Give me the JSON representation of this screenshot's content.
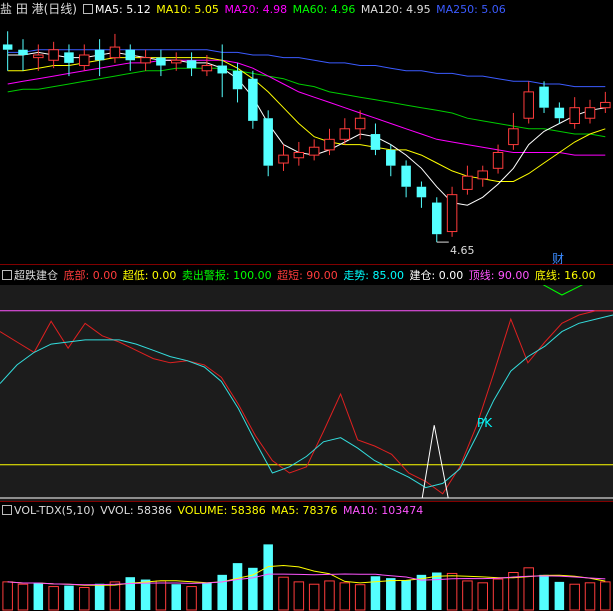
{
  "header": {
    "title": "盐 田 港(日线)",
    "indicators": [
      {
        "label": "MA5: 5.12",
        "color": "#ffffff"
      },
      {
        "label": "MA10: 5.05",
        "color": "#ffff00"
      },
      {
        "label": "MA20: 4.98",
        "color": "#ff00ff"
      },
      {
        "label": "MA60: 4.96",
        "color": "#00ff00"
      },
      {
        "label": "MA120: 4.95",
        "color": "#dddddd"
      },
      {
        "label": "MA250: 5.06",
        "color": "#3b5bff"
      }
    ]
  },
  "price_chart": {
    "low_marker": "4.65",
    "finance_badge": "财",
    "candles": [
      [
        5.4,
        5.38,
        5.45,
        5.3
      ],
      [
        5.38,
        5.36,
        5.42,
        5.3
      ],
      [
        5.35,
        5.36,
        5.4,
        5.3
      ],
      [
        5.34,
        5.38,
        5.41,
        5.31
      ],
      [
        5.37,
        5.33,
        5.4,
        5.28
      ],
      [
        5.32,
        5.36,
        5.4,
        5.3
      ],
      [
        5.38,
        5.34,
        5.42,
        5.28
      ],
      [
        5.35,
        5.39,
        5.44,
        5.33
      ],
      [
        5.38,
        5.34,
        5.4,
        5.3
      ],
      [
        5.33,
        5.35,
        5.38,
        5.3
      ],
      [
        5.35,
        5.32,
        5.38,
        5.28
      ],
      [
        5.33,
        5.34,
        5.37,
        5.3
      ],
      [
        5.34,
        5.31,
        5.37,
        5.28
      ],
      [
        5.3,
        5.32,
        5.36,
        5.28
      ],
      [
        5.32,
        5.29,
        5.4,
        5.2
      ],
      [
        5.3,
        5.23,
        5.33,
        5.18
      ],
      [
        5.27,
        5.11,
        5.3,
        5.08
      ],
      [
        5.12,
        4.94,
        5.15,
        4.9
      ],
      [
        4.95,
        4.98,
        5.02,
        4.92
      ],
      [
        4.97,
        4.99,
        5.03,
        4.94
      ],
      [
        4.98,
        5.01,
        5.04,
        4.96
      ],
      [
        5.0,
        5.04,
        5.08,
        4.98
      ],
      [
        5.04,
        5.08,
        5.12,
        5.02
      ],
      [
        5.08,
        5.12,
        5.15,
        5.04
      ],
      [
        5.06,
        5.0,
        5.1,
        4.98
      ],
      [
        5.0,
        4.94,
        5.02,
        4.9
      ],
      [
        4.94,
        4.86,
        4.96,
        4.82
      ],
      [
        4.86,
        4.82,
        4.88,
        4.78
      ],
      [
        4.8,
        4.68,
        4.82,
        4.65
      ],
      [
        4.69,
        4.83,
        4.86,
        4.67
      ],
      [
        4.85,
        4.9,
        4.94,
        4.83
      ],
      [
        4.89,
        4.92,
        4.94,
        4.86
      ],
      [
        4.93,
        4.99,
        5.02,
        4.91
      ],
      [
        5.02,
        5.08,
        5.14,
        5.0
      ],
      [
        5.12,
        5.22,
        5.26,
        5.1
      ],
      [
        5.24,
        5.16,
        5.26,
        5.14
      ],
      [
        5.16,
        5.12,
        5.18,
        5.1
      ],
      [
        5.1,
        5.16,
        5.2,
        5.08
      ],
      [
        5.12,
        5.16,
        5.19,
        5.1
      ],
      [
        5.16,
        5.18,
        5.22,
        5.14
      ]
    ],
    "ma5": [
      5.36,
      5.36,
      5.37,
      5.36,
      5.35,
      5.35,
      5.36,
      5.37,
      5.36,
      5.35,
      5.34,
      5.34,
      5.33,
      5.33,
      5.31,
      5.27,
      5.2,
      5.1,
      5.02,
      4.99,
      4.98,
      5.0,
      5.03,
      5.06,
      5.05,
      5.02,
      4.98,
      4.93,
      4.86,
      4.8,
      4.79,
      4.82,
      4.87,
      4.93,
      5.02,
      5.07,
      5.1,
      5.13,
      5.15,
      5.16
    ],
    "ma10": [
      5.3,
      5.3,
      5.31,
      5.32,
      5.32,
      5.33,
      5.34,
      5.35,
      5.35,
      5.35,
      5.35,
      5.35,
      5.35,
      5.35,
      5.34,
      5.31,
      5.27,
      5.22,
      5.16,
      5.1,
      5.05,
      5.03,
      5.02,
      5.02,
      5.01,
      5.0,
      5.0,
      4.98,
      4.95,
      4.92,
      4.9,
      4.89,
      4.88,
      4.88,
      4.91,
      4.95,
      4.99,
      5.03,
      5.06,
      5.08
    ],
    "ma20": [
      5.25,
      5.26,
      5.27,
      5.28,
      5.29,
      5.3,
      5.31,
      5.32,
      5.33,
      5.33,
      5.34,
      5.34,
      5.34,
      5.34,
      5.34,
      5.33,
      5.31,
      5.28,
      5.25,
      5.22,
      5.2,
      5.18,
      5.16,
      5.14,
      5.12,
      5.1,
      5.08,
      5.06,
      5.04,
      5.03,
      5.02,
      5.01,
      5.0,
      4.99,
      4.99,
      4.99,
      4.99,
      4.98,
      4.98,
      4.98
    ],
    "ma60": [
      5.22,
      5.23,
      5.23,
      5.24,
      5.25,
      5.26,
      5.27,
      5.28,
      5.29,
      5.3,
      5.3,
      5.31,
      5.31,
      5.31,
      5.31,
      5.3,
      5.29,
      5.28,
      5.27,
      5.25,
      5.24,
      5.22,
      5.21,
      5.2,
      5.19,
      5.18,
      5.17,
      5.16,
      5.15,
      5.14,
      5.12,
      5.11,
      5.1,
      5.09,
      5.08,
      5.08,
      5.07,
      5.06,
      5.06,
      5.05
    ],
    "ma250": [
      5.37,
      5.37,
      5.38,
      5.38,
      5.38,
      5.38,
      5.38,
      5.38,
      5.38,
      5.38,
      5.38,
      5.38,
      5.38,
      5.38,
      5.37,
      5.37,
      5.36,
      5.36,
      5.35,
      5.35,
      5.34,
      5.33,
      5.33,
      5.32,
      5.32,
      5.31,
      5.3,
      5.3,
      5.29,
      5.29,
      5.28,
      5.28,
      5.27,
      5.26,
      5.26,
      5.25,
      5.25,
      5.24,
      5.24,
      5.24
    ]
  },
  "ind_header": {
    "title": "超跌建仓",
    "items": [
      {
        "label": "底部: 0.00",
        "color": "#ff3c3c"
      },
      {
        "label": "超低: 0.00",
        "color": "#ffff00"
      },
      {
        "label": "卖出警报: 100.00",
        "color": "#00ff00"
      },
      {
        "label": "超短: 90.00",
        "color": "#ff3c3c"
      },
      {
        "label": "走势: 85.00",
        "color": "#00ffff"
      },
      {
        "label": "建仓: 0.00",
        "color": "#ffffff"
      },
      {
        "label": "顶线: 90.00",
        "color": "#ff55ff"
      },
      {
        "label": "底线: 16.00",
        "color": "#ffff00"
      }
    ],
    "pk_label": "PK",
    "top_line": 90,
    "bottom_line": 16,
    "red_line": [
      80,
      75,
      70,
      85,
      72,
      84,
      78,
      75,
      71,
      67,
      65,
      66,
      64,
      58,
      45,
      30,
      18,
      12,
      15,
      32,
      50,
      28,
      25,
      21,
      12,
      8,
      2,
      15,
      35,
      60,
      86,
      65,
      75,
      84,
      88,
      90,
      90
    ],
    "cyan_line": [
      55,
      64,
      70,
      74,
      75,
      76,
      76,
      76,
      74,
      71,
      68,
      66,
      63,
      56,
      43,
      27,
      12,
      15,
      20,
      27,
      29,
      24,
      18,
      14,
      10,
      5,
      7,
      14,
      30,
      47,
      61,
      68,
      73,
      80,
      84,
      86,
      88
    ]
  },
  "vol_header": {
    "title": "VOL-TDX(5,10)",
    "items": [
      {
        "label": "VVOL: 58386",
        "color": "#dddddd"
      },
      {
        "label": "VOLUME: 58386",
        "color": "#ffff00"
      },
      {
        "label": "MA5: 78376",
        "color": "#ffff00"
      },
      {
        "label": "MA10: 103474",
        "color": "#ff55ff"
      }
    ],
    "volumes": [
      [
        60,
        "up"
      ],
      [
        55,
        "up"
      ],
      [
        58,
        "down"
      ],
      [
        50,
        "up"
      ],
      [
        52,
        "down"
      ],
      [
        48,
        "up"
      ],
      [
        56,
        "down"
      ],
      [
        60,
        "up"
      ],
      [
        70,
        "down"
      ],
      [
        65,
        "down"
      ],
      [
        62,
        "up"
      ],
      [
        55,
        "down"
      ],
      [
        50,
        "up"
      ],
      [
        58,
        "down"
      ],
      [
        75,
        "down"
      ],
      [
        100,
        "down"
      ],
      [
        90,
        "down"
      ],
      [
        140,
        "down"
      ],
      [
        70,
        "up"
      ],
      [
        60,
        "up"
      ],
      [
        55,
        "up"
      ],
      [
        62,
        "up"
      ],
      [
        58,
        "up"
      ],
      [
        54,
        "up"
      ],
      [
        72,
        "down"
      ],
      [
        68,
        "down"
      ],
      [
        64,
        "down"
      ],
      [
        75,
        "down"
      ],
      [
        80,
        "down"
      ],
      [
        78,
        "up"
      ],
      [
        62,
        "up"
      ],
      [
        58,
        "up"
      ],
      [
        66,
        "up"
      ],
      [
        80,
        "up"
      ],
      [
        90,
        "up"
      ],
      [
        75,
        "down"
      ],
      [
        60,
        "down"
      ],
      [
        55,
        "up"
      ],
      [
        58,
        "up"
      ],
      [
        60,
        "up"
      ]
    ]
  }
}
